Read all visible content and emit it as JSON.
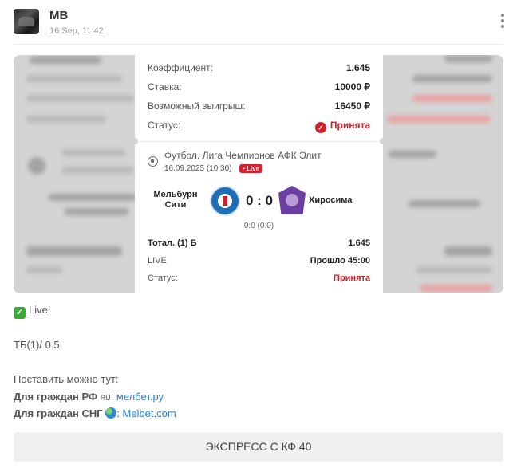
{
  "post": {
    "author": "MB",
    "timestamp": "16 Sep, 11:42"
  },
  "bet_card": {
    "rows": [
      {
        "label": "Коэффициент:",
        "value": "1.645"
      },
      {
        "label": "Ставка:",
        "value": "10000 ₽"
      },
      {
        "label": "Возможный выигрыш:",
        "value": "16450 ₽"
      },
      {
        "label": "Статус:",
        "value": "Принята"
      }
    ],
    "league": "Футбол. Лига Чемпионов АФК Элит",
    "match_date": "16.09.2025 (10:30)",
    "live_badge": "• Live",
    "home_team": "Мельбурн Сити",
    "away_team": "Хиросима",
    "score": "0 : 0",
    "half_score": "0:0 (0:0)",
    "selection": [
      {
        "label": "Тотал. (1) Б",
        "value": "1.645"
      },
      {
        "label": "LIVE",
        "value": "Прошло 45:00"
      },
      {
        "label": "Статус:",
        "value": "Принята"
      }
    ]
  },
  "message": {
    "live_line": "Live!",
    "bet_line": "ТБ(1)/ 0.5",
    "place_here": "Поставить можно тут:",
    "rf_label": "Для граждан РФ",
    "rf_tag": "RU",
    "rf_link": "мелбет.ру",
    "cis_label": "Для граждан СНГ",
    "cis_link": "Melbet.com"
  },
  "express_button": "ЭКСПРЕСС С КФ 40",
  "colors": {
    "accent_red": "#d0202b",
    "link_blue": "#2a7fd4",
    "check_green": "#3aa935"
  },
  "icons": [
    "more-vertical-icon",
    "check-circle-icon",
    "soccer-ball-icon",
    "check-mark-icon",
    "globe-icon"
  ]
}
